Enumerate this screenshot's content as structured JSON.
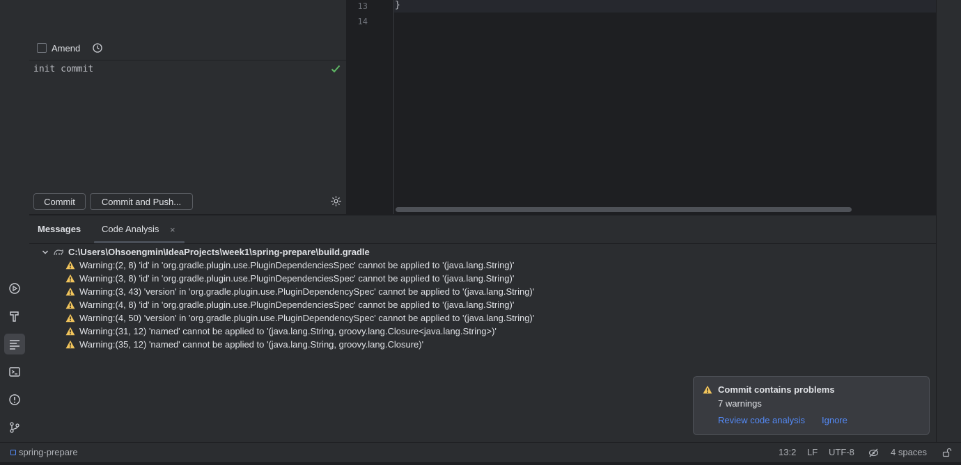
{
  "commit_panel": {
    "amend_label": "Amend",
    "commit_message": "init commit",
    "commit_button": "Commit",
    "commit_push_button": "Commit and Push..."
  },
  "editor": {
    "line_numbers": [
      "13",
      "14"
    ],
    "line13_text": "}"
  },
  "bottom_panel": {
    "tabs": [
      {
        "label": "Messages"
      },
      {
        "label": "Code Analysis"
      }
    ],
    "tab_close": "×",
    "root_path": "C:\\Users\\Ohsoengmin\\IdeaProjects\\week1\\spring-prepare\\build.gradle",
    "warnings": [
      {
        "text": "Warning:(2, 8)  'id' in 'org.gradle.plugin.use.PluginDependenciesSpec' cannot be applied to '(java.lang.String)'"
      },
      {
        "text": "Warning:(3, 8)  'id' in 'org.gradle.plugin.use.PluginDependenciesSpec' cannot be applied to '(java.lang.String)'"
      },
      {
        "text": "Warning:(3, 43)  'version' in 'org.gradle.plugin.use.PluginDependencySpec' cannot be applied to '(java.lang.String)'"
      },
      {
        "text": "Warning:(4, 8)  'id' in 'org.gradle.plugin.use.PluginDependenciesSpec' cannot be applied to '(java.lang.String)'"
      },
      {
        "text": "Warning:(4, 50)  'version' in 'org.gradle.plugin.use.PluginDependencySpec' cannot be applied to '(java.lang.String)'"
      },
      {
        "text": "Warning:(31, 12)  'named' cannot be applied to '(java.lang.String, groovy.lang.Closure<java.lang.String>)'"
      },
      {
        "text": "Warning:(35, 12)  'named' cannot be applied to '(java.lang.String, groovy.lang.Closure)'"
      }
    ]
  },
  "notification": {
    "title": "Commit contains problems",
    "subtitle": "7 warnings",
    "review_link": "Review code analysis",
    "ignore_link": "Ignore"
  },
  "statusbar": {
    "project": "spring-prepare",
    "position": "13:2",
    "line_ending": "LF",
    "encoding": "UTF-8",
    "indent": "4 spaces"
  },
  "colors": {
    "warning": "#f2c55c",
    "success": "#5fb865",
    "link": "#548af7"
  }
}
